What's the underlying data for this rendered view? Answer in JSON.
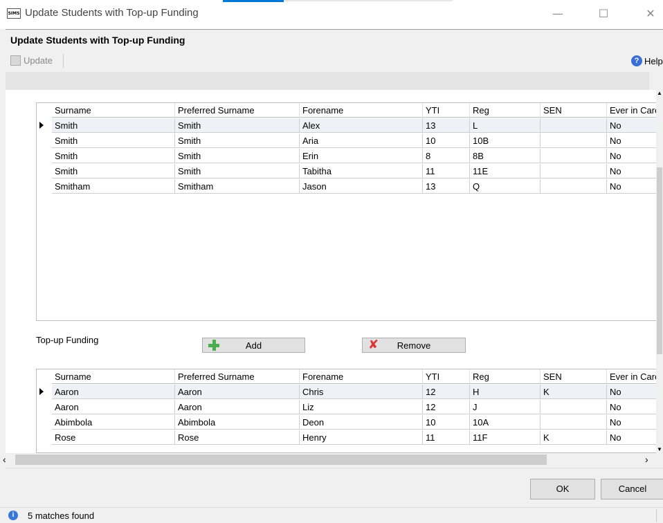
{
  "window": {
    "app_icon_text": "SIMS",
    "title": "Update Students with Top-up Funding",
    "controls": {
      "minimize": "—",
      "maximize": "☐",
      "close": "✕"
    }
  },
  "header": {
    "title": "Update Students with Top-up Funding"
  },
  "toolbar": {
    "update_label": "Update",
    "help_label": "Help"
  },
  "grid1": {
    "columns": [
      "Surname",
      "Preferred Surname",
      "Forename",
      "YTI",
      "Reg",
      "SEN",
      "Ever in Care"
    ],
    "rows": [
      {
        "selected": true,
        "cells": [
          "Smith",
          "Smith",
          "Alex",
          "13",
          "L",
          "",
          "No"
        ]
      },
      {
        "selected": false,
        "cells": [
          "Smith",
          "Smith",
          "Aria",
          "10",
          "10B",
          "",
          "No"
        ]
      },
      {
        "selected": false,
        "cells": [
          "Smith",
          "Smith",
          "Erin",
          "8",
          "8B",
          "",
          "No"
        ]
      },
      {
        "selected": false,
        "cells": [
          "Smith",
          "Smith",
          "Tabitha",
          "11",
          "11E",
          "",
          "No"
        ]
      },
      {
        "selected": false,
        "cells": [
          "Smitham",
          "Smitham",
          "Jason",
          "13",
          "Q",
          "",
          "No"
        ]
      }
    ]
  },
  "topup": {
    "label": "Top-up Funding",
    "add_label": "Add",
    "remove_label": "Remove"
  },
  "grid2": {
    "columns": [
      "Surname",
      "Preferred Surname",
      "Forename",
      "YTI",
      "Reg",
      "SEN",
      "Ever in Care"
    ],
    "rows": [
      {
        "selected": true,
        "cells": [
          "Aaron",
          "Aaron",
          "Chris",
          "12",
          "H",
          "K",
          "No"
        ]
      },
      {
        "selected": false,
        "cells": [
          "Aaron",
          "Aaron",
          "Liz",
          "12",
          "J",
          "",
          "No"
        ]
      },
      {
        "selected": false,
        "cells": [
          "Abimbola",
          "Abimbola",
          "Deon",
          "10",
          "10A",
          "",
          "No"
        ]
      },
      {
        "selected": false,
        "cells": [
          "Rose",
          "Rose",
          "Henry",
          "11",
          "11F",
          "K",
          "No"
        ]
      }
    ]
  },
  "footer": {
    "ok_label": "OK",
    "cancel_label": "Cancel"
  },
  "status": {
    "text": "5 matches found"
  }
}
